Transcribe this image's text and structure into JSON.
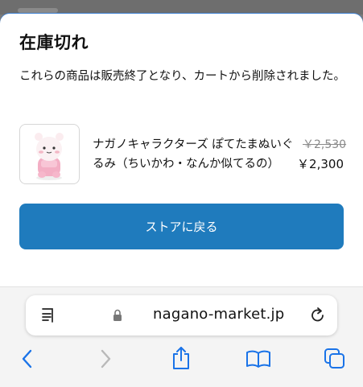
{
  "dialog": {
    "title": "在庫切れ",
    "message": "これらの商品は販売終了となり、カートから削除されました。",
    "button_label": "ストアに戻る"
  },
  "product": {
    "name": "ナガノキャラクターズ ぽてたまぬいぐるみ（ちいかわ・なんか似てるの）",
    "original_price": "￥2,530",
    "price": "￥2,300"
  },
  "browser": {
    "url": "nagano-market.jp"
  },
  "colors": {
    "accent": "#1f7bbd",
    "ios_blue": "#1a73e8",
    "disabled_gray": "#b9b9b9"
  }
}
